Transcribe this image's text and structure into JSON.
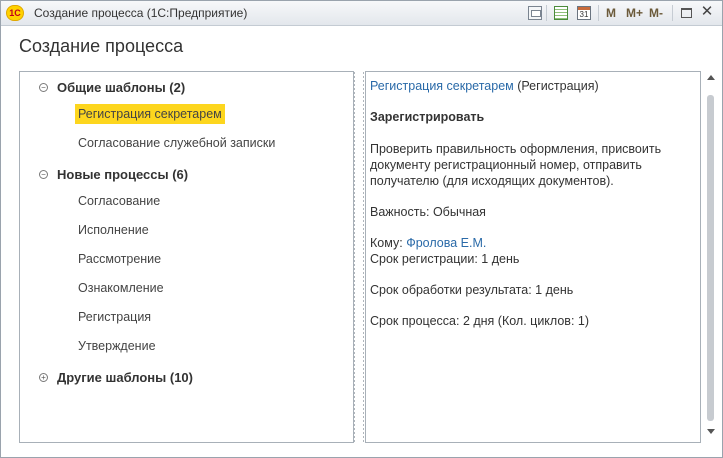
{
  "window": {
    "title": "Создание процесса (1С:Предприятие)",
    "logo_text": "1C",
    "toolbar": {
      "calendar_day": "31",
      "m": "M",
      "m_plus": "M+",
      "m_minus": "M-",
      "close": "✕"
    }
  },
  "page_title": "Создание процесса",
  "tree": {
    "groups": [
      {
        "expander": "−",
        "label": "Общие шаблоны (2)",
        "expanded": true,
        "items": [
          {
            "label": "Регистрация секретарем",
            "selected": true
          },
          {
            "label": "Согласование служебной записки",
            "selected": false
          }
        ]
      },
      {
        "expander": "−",
        "label": "Новые процессы (6)",
        "expanded": true,
        "items": [
          {
            "label": "Согласование",
            "selected": false
          },
          {
            "label": "Исполнение",
            "selected": false
          },
          {
            "label": "Рассмотрение",
            "selected": false
          },
          {
            "label": "Ознакомление",
            "selected": false
          },
          {
            "label": "Регистрация",
            "selected": false
          },
          {
            "label": "Утверждение",
            "selected": false
          }
        ]
      },
      {
        "expander": "+",
        "label": "Другие шаблоны (10)",
        "expanded": false,
        "items": []
      }
    ]
  },
  "detail": {
    "template_link": "Регистрация секретарем",
    "template_type": "(Регистрация)",
    "action_title": "Зарегистрировать",
    "description_lines": [
      "Проверить правильность оформления, присвоить",
      "документу регистрационный номер, отправить",
      "получателю (для исходящих документов)."
    ],
    "importance_label": "Важность:",
    "importance_value": "Обычная",
    "to_label": "Кому:",
    "to_value": "Фролова Е.М.",
    "reg_term_label": "Срок регистрации:",
    "reg_term_value": "1 день",
    "result_term_label": "Срок обработки результата:",
    "result_term_value": "1 день",
    "process_term_label": "Срок процесса:",
    "process_term_value": "2 дня (Кол. циклов: 1)"
  },
  "colors": {
    "selection": "#fdd61e",
    "link": "#2a6aa8"
  }
}
